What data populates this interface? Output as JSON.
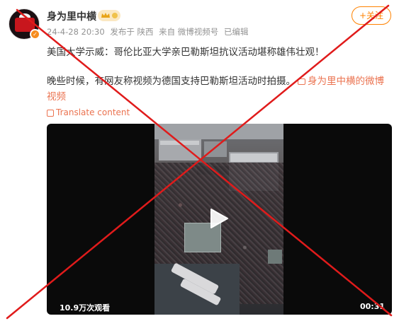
{
  "post": {
    "username": "身为里中横",
    "meta": {
      "datetime": "24-4-28 20:30",
      "location": "发布于 陕西",
      "source": "来自 微博视频号",
      "edited": "已编辑"
    },
    "follow_label": "+关注",
    "text_line1": "美国大学示威：哥伦比亚大学亲巴勒斯坦抗议活动堪称雄伟壮观！",
    "text_line2": "晚些时候，有网友称视频为德国支持巴勒斯坦活动时拍摄。",
    "text_link": "身为里中横的微博视频",
    "translate_label": "Translate content"
  },
  "video": {
    "views": "10.9万次观看",
    "duration": "00:31"
  },
  "icons": {
    "avatar": "avatar",
    "verified": "verified-badge-icon",
    "crown": "crown-badge-icon",
    "link": "video-link-icon",
    "translate": "translate-icon",
    "play": "play-icon",
    "red_cross": "red-x-overlay"
  },
  "colors": {
    "accent": "#ff8200",
    "link": "#eb7350",
    "overlay": "#e01b1b",
    "verified": "#f78c1e"
  }
}
